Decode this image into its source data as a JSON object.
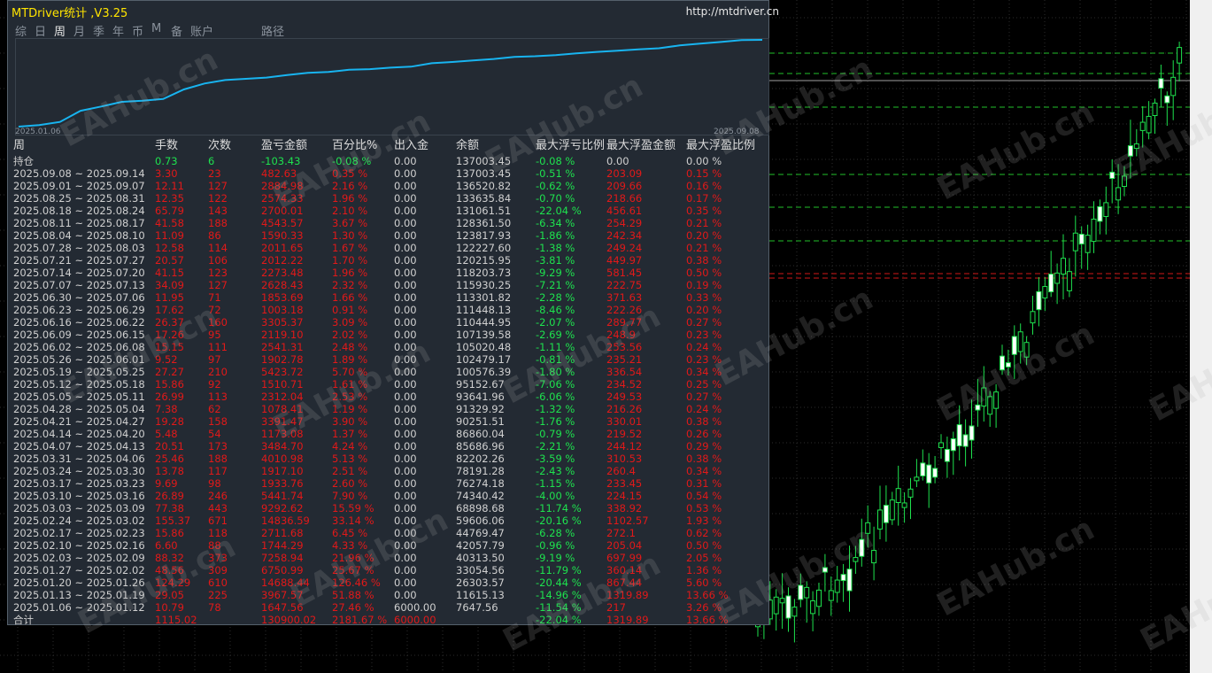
{
  "app": {
    "title": "MTDriver统计 ,V3.25",
    "url": "http://mtdriver.cn"
  },
  "tabs": [
    {
      "label": "综"
    },
    {
      "label": "日"
    },
    {
      "label": "周",
      "active": true
    },
    {
      "label": "月"
    },
    {
      "label": "季"
    },
    {
      "label": "年"
    },
    {
      "label": "币"
    },
    {
      "label": "M"
    },
    {
      "label": "备"
    },
    {
      "label": "账户"
    },
    {
      "label": "路径"
    }
  ],
  "equity": {
    "start_date": "2025.01.06",
    "end_date": "2025.09.08",
    "line_color": "#18b4f0",
    "values": [
      1647.56,
      4000,
      9000,
      26303,
      33054,
      40313,
      42057,
      44769,
      59606,
      68898,
      74340,
      76274,
      78191,
      82202,
      85686,
      86860,
      90251,
      91329,
      93641,
      95152,
      100576,
      102479,
      105020,
      107139,
      110444,
      111448,
      113301,
      115930,
      118203,
      120215,
      122227,
      123817,
      128361,
      131061,
      133635,
      136520,
      137003
    ]
  },
  "table": {
    "headers": [
      "周",
      "手数",
      "次数",
      "盈亏金额",
      "百分比%",
      "出入金",
      "余额",
      "最大浮亏比例",
      "最大浮盈金额",
      "最大浮盈比例"
    ],
    "holding": {
      "label": "持仓",
      "lots": "0.73",
      "count": "6",
      "pnl": "-103.43",
      "pct": "-0.08 %",
      "inout": "0.00",
      "balance": "137003.45",
      "maxdd": "-0.08 %",
      "maxprofit": "0.00",
      "maxprofit_pct": "0.00 %"
    },
    "rows": [
      {
        "week": "2025.09.08 ~ 2025.09.14",
        "lots": "3.30",
        "count": "23",
        "pnl": "482.63",
        "pct": "0.35 %",
        "inout": "0.00",
        "balance": "137003.45",
        "maxdd": "-0.51 %",
        "maxprofit": "203.09",
        "maxprofit_pct": "0.15 %"
      },
      {
        "week": "2025.09.01 ~ 2025.09.07",
        "lots": "12.11",
        "count": "127",
        "pnl": "2884.98",
        "pct": "2.16 %",
        "inout": "0.00",
        "balance": "136520.82",
        "maxdd": "-0.62 %",
        "maxprofit": "209.66",
        "maxprofit_pct": "0.16 %"
      },
      {
        "week": "2025.08.25 ~ 2025.08.31",
        "lots": "12.35",
        "count": "122",
        "pnl": "2574.33",
        "pct": "1.96 %",
        "inout": "0.00",
        "balance": "133635.84",
        "maxdd": "-0.70 %",
        "maxprofit": "218.66",
        "maxprofit_pct": "0.17 %"
      },
      {
        "week": "2025.08.18 ~ 2025.08.24",
        "lots": "65.79",
        "count": "143",
        "pnl": "2700.01",
        "pct": "2.10 %",
        "inout": "0.00",
        "balance": "131061.51",
        "maxdd": "-22.04 %",
        "maxprofit": "456.61",
        "maxprofit_pct": "0.35 %"
      },
      {
        "week": "2025.08.11 ~ 2025.08.17",
        "lots": "41.58",
        "count": "188",
        "pnl": "4543.57",
        "pct": "3.67 %",
        "inout": "0.00",
        "balance": "128361.50",
        "maxdd": "-6.34 %",
        "maxprofit": "254.29",
        "maxprofit_pct": "0.21 %"
      },
      {
        "week": "2025.08.04 ~ 2025.08.10",
        "lots": "11.09",
        "count": "86",
        "pnl": "1590.33",
        "pct": "1.30 %",
        "inout": "0.00",
        "balance": "123817.93",
        "maxdd": "-1.86 %",
        "maxprofit": "242.34",
        "maxprofit_pct": "0.20 %"
      },
      {
        "week": "2025.07.28 ~ 2025.08.03",
        "lots": "12.58",
        "count": "114",
        "pnl": "2011.65",
        "pct": "1.67 %",
        "inout": "0.00",
        "balance": "122227.60",
        "maxdd": "-1.38 %",
        "maxprofit": "249.24",
        "maxprofit_pct": "0.21 %"
      },
      {
        "week": "2025.07.21 ~ 2025.07.27",
        "lots": "20.57",
        "count": "106",
        "pnl": "2012.22",
        "pct": "1.70 %",
        "inout": "0.00",
        "balance": "120215.95",
        "maxdd": "-3.81 %",
        "maxprofit": "449.97",
        "maxprofit_pct": "0.38 %"
      },
      {
        "week": "2025.07.14 ~ 2025.07.20",
        "lots": "41.15",
        "count": "123",
        "pnl": "2273.48",
        "pct": "1.96 %",
        "inout": "0.00",
        "balance": "118203.73",
        "maxdd": "-9.29 %",
        "maxprofit": "581.45",
        "maxprofit_pct": "0.50 %"
      },
      {
        "week": "2025.07.07 ~ 2025.07.13",
        "lots": "34.09",
        "count": "127",
        "pnl": "2628.43",
        "pct": "2.32 %",
        "inout": "0.00",
        "balance": "115930.25",
        "maxdd": "-7.21 %",
        "maxprofit": "222.75",
        "maxprofit_pct": "0.19 %"
      },
      {
        "week": "2025.06.30 ~ 2025.07.06",
        "lots": "11.95",
        "count": "71",
        "pnl": "1853.69",
        "pct": "1.66 %",
        "inout": "0.00",
        "balance": "113301.82",
        "maxdd": "-2.28 %",
        "maxprofit": "371.63",
        "maxprofit_pct": "0.33 %"
      },
      {
        "week": "2025.06.23 ~ 2025.06.29",
        "lots": "17.62",
        "count": "72",
        "pnl": "1003.18",
        "pct": "0.91 %",
        "inout": "0.00",
        "balance": "111448.13",
        "maxdd": "-8.46 %",
        "maxprofit": "222.26",
        "maxprofit_pct": "0.20 %"
      },
      {
        "week": "2025.06.16 ~ 2025.06.22",
        "lots": "26.37",
        "count": "160",
        "pnl": "3305.37",
        "pct": "3.09 %",
        "inout": "0.00",
        "balance": "110444.95",
        "maxdd": "-2.07 %",
        "maxprofit": "289.77",
        "maxprofit_pct": "0.27 %"
      },
      {
        "week": "2025.06.09 ~ 2025.06.15",
        "lots": "17.26",
        "count": "95",
        "pnl": "2119.10",
        "pct": "2.02 %",
        "inout": "0.00",
        "balance": "107139.58",
        "maxdd": "-2.69 %",
        "maxprofit": "248.9",
        "maxprofit_pct": "0.23 %"
      },
      {
        "week": "2025.06.02 ~ 2025.06.08",
        "lots": "15.15",
        "count": "111",
        "pnl": "2541.31",
        "pct": "2.48 %",
        "inout": "0.00",
        "balance": "105020.48",
        "maxdd": "-1.11 %",
        "maxprofit": "253.56",
        "maxprofit_pct": "0.24 %"
      },
      {
        "week": "2025.05.26 ~ 2025.06.01",
        "lots": "9.52",
        "count": "97",
        "pnl": "1902.78",
        "pct": "1.89 %",
        "inout": "0.00",
        "balance": "102479.17",
        "maxdd": "-0.81 %",
        "maxprofit": "235.21",
        "maxprofit_pct": "0.23 %"
      },
      {
        "week": "2025.05.19 ~ 2025.05.25",
        "lots": "27.27",
        "count": "210",
        "pnl": "5423.72",
        "pct": "5.70 %",
        "inout": "0.00",
        "balance": "100576.39",
        "maxdd": "-1.80 %",
        "maxprofit": "336.54",
        "maxprofit_pct": "0.34 %"
      },
      {
        "week": "2025.05.12 ~ 2025.05.18",
        "lots": "15.86",
        "count": "92",
        "pnl": "1510.71",
        "pct": "1.61 %",
        "inout": "0.00",
        "balance": "95152.67",
        "maxdd": "-7.06 %",
        "maxprofit": "234.52",
        "maxprofit_pct": "0.25 %"
      },
      {
        "week": "2025.05.05 ~ 2025.05.11",
        "lots": "26.99",
        "count": "113",
        "pnl": "2312.04",
        "pct": "2.53 %",
        "inout": "0.00",
        "balance": "93641.96",
        "maxdd": "-6.06 %",
        "maxprofit": "249.53",
        "maxprofit_pct": "0.27 %"
      },
      {
        "week": "2025.04.28 ~ 2025.05.04",
        "lots": "7.38",
        "count": "62",
        "pnl": "1078.41",
        "pct": "1.19 %",
        "inout": "0.00",
        "balance": "91329.92",
        "maxdd": "-1.32 %",
        "maxprofit": "216.26",
        "maxprofit_pct": "0.24 %"
      },
      {
        "week": "2025.04.21 ~ 2025.04.27",
        "lots": "19.28",
        "count": "158",
        "pnl": "3391.47",
        "pct": "3.90 %",
        "inout": "0.00",
        "balance": "90251.51",
        "maxdd": "-1.76 %",
        "maxprofit": "330.01",
        "maxprofit_pct": "0.38 %"
      },
      {
        "week": "2025.04.14 ~ 2025.04.20",
        "lots": "5.48",
        "count": "54",
        "pnl": "1173.08",
        "pct": "1.37 %",
        "inout": "0.00",
        "balance": "86860.04",
        "maxdd": "-0.79 %",
        "maxprofit": "219.52",
        "maxprofit_pct": "0.26 %"
      },
      {
        "week": "2025.04.07 ~ 2025.04.13",
        "lots": "20.51",
        "count": "173",
        "pnl": "3484.70",
        "pct": "4.24 %",
        "inout": "0.00",
        "balance": "85686.96",
        "maxdd": "-2.21 %",
        "maxprofit": "244.12",
        "maxprofit_pct": "0.29 %"
      },
      {
        "week": "2025.03.31 ~ 2025.04.06",
        "lots": "25.46",
        "count": "188",
        "pnl": "4010.98",
        "pct": "5.13 %",
        "inout": "0.00",
        "balance": "82202.26",
        "maxdd": "-3.59 %",
        "maxprofit": "310.53",
        "maxprofit_pct": "0.38 %"
      },
      {
        "week": "2025.03.24 ~ 2025.03.30",
        "lots": "13.78",
        "count": "117",
        "pnl": "1917.10",
        "pct": "2.51 %",
        "inout": "0.00",
        "balance": "78191.28",
        "maxdd": "-2.43 %",
        "maxprofit": "260.4",
        "maxprofit_pct": "0.34 %"
      },
      {
        "week": "2025.03.17 ~ 2025.03.23",
        "lots": "9.69",
        "count": "98",
        "pnl": "1933.76",
        "pct": "2.60 %",
        "inout": "0.00",
        "balance": "76274.18",
        "maxdd": "-1.15 %",
        "maxprofit": "233.45",
        "maxprofit_pct": "0.31 %"
      },
      {
        "week": "2025.03.10 ~ 2025.03.16",
        "lots": "26.89",
        "count": "246",
        "pnl": "5441.74",
        "pct": "7.90 %",
        "inout": "0.00",
        "balance": "74340.42",
        "maxdd": "-4.00 %",
        "maxprofit": "224.15",
        "maxprofit_pct": "0.54 %"
      },
      {
        "week": "2025.03.03 ~ 2025.03.09",
        "lots": "77.38",
        "count": "443",
        "pnl": "9292.62",
        "pct": "15.59 %",
        "inout": "0.00",
        "balance": "68898.68",
        "maxdd": "-11.74 %",
        "maxprofit": "338.92",
        "maxprofit_pct": "0.53 %"
      },
      {
        "week": "2025.02.24 ~ 2025.03.02",
        "lots": "155.37",
        "count": "671",
        "pnl": "14836.59",
        "pct": "33.14 %",
        "inout": "0.00",
        "balance": "59606.06",
        "maxdd": "-20.16 %",
        "maxprofit": "1102.57",
        "maxprofit_pct": "1.93 %"
      },
      {
        "week": "2025.02.17 ~ 2025.02.23",
        "lots": "15.86",
        "count": "118",
        "pnl": "2711.68",
        "pct": "6.45 %",
        "inout": "0.00",
        "balance": "44769.47",
        "maxdd": "-6.28 %",
        "maxprofit": "272.1",
        "maxprofit_pct": "0.62 %"
      },
      {
        "week": "2025.02.10 ~ 2025.02.16",
        "lots": "6.60",
        "count": "88",
        "pnl": "1744.29",
        "pct": "4.33 %",
        "inout": "0.00",
        "balance": "42057.79",
        "maxdd": "-0.96 %",
        "maxprofit": "205.04",
        "maxprofit_pct": "0.50 %"
      },
      {
        "week": "2025.02.03 ~ 2025.02.09",
        "lots": "88.32",
        "count": "373",
        "pnl": "7258.94",
        "pct": "21.96 %",
        "inout": "0.00",
        "balance": "40313.50",
        "maxdd": "-9.19 %",
        "maxprofit": "697.99",
        "maxprofit_pct": "2.05 %"
      },
      {
        "week": "2025.01.27 ~ 2025.02.02",
        "lots": "48.56",
        "count": "309",
        "pnl": "6750.99",
        "pct": "25.67 %",
        "inout": "0.00",
        "balance": "33054.56",
        "maxdd": "-11.79 %",
        "maxprofit": "360.14",
        "maxprofit_pct": "1.36 %"
      },
      {
        "week": "2025.01.20 ~ 2025.01.26",
        "lots": "124.29",
        "count": "610",
        "pnl": "14688.44",
        "pct": "126.46 %",
        "inout": "0.00",
        "balance": "26303.57",
        "maxdd": "-20.44 %",
        "maxprofit": "867.44",
        "maxprofit_pct": "5.60 %"
      },
      {
        "week": "2025.01.13 ~ 2025.01.19",
        "lots": "29.05",
        "count": "225",
        "pnl": "3967.57",
        "pct": "51.88 %",
        "inout": "0.00",
        "balance": "11615.13",
        "maxdd": "-14.96 %",
        "maxprofit": "1319.89",
        "maxprofit_pct": "13.66 %"
      },
      {
        "week": "2025.01.06 ~ 2025.01.12",
        "lots": "10.79",
        "count": "78",
        "pnl": "1647.56",
        "pct": "27.46 %",
        "inout": "6000.00",
        "balance": "7647.56",
        "maxdd": "-11.54 %",
        "maxprofit": "217",
        "maxprofit_pct": "3.26 %"
      }
    ],
    "total": {
      "label": "合计",
      "lots": "1115.02",
      "count": "",
      "pnl": "130900.02",
      "pct": "2181.67 %",
      "inout": "6000.00",
      "balance": "",
      "maxdd": "-22.04 %",
      "maxprofit": "1319.89",
      "maxprofit_pct": "13.66 %"
    }
  },
  "watermark": "EAHub.cn",
  "colors": {
    "panel_bg": "#232a33",
    "loss_text": "#e11919",
    "profit_text": "#1ee24e",
    "title_text": "#ffe400",
    "equity_line": "#18b4f0",
    "candle_up": "#1ee24e",
    "grid": "#2a2a2a"
  }
}
